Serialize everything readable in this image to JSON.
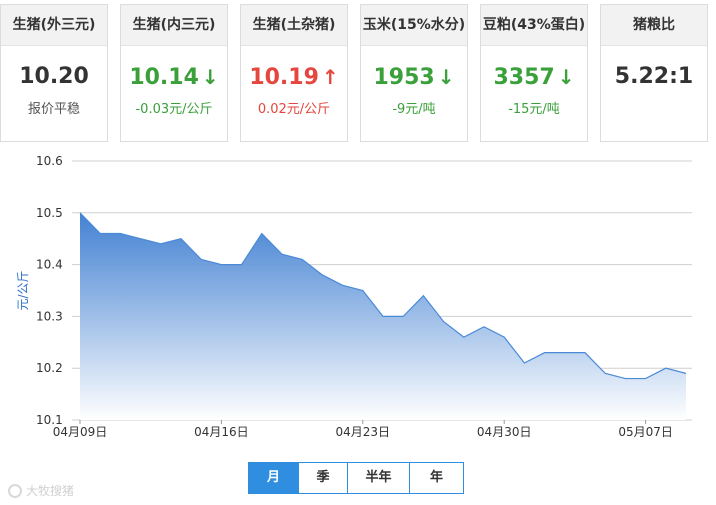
{
  "cards": [
    {
      "title": "生猪(外三元)",
      "value": "10.20",
      "arrow": "",
      "sub": "报价平稳",
      "trend": "flat"
    },
    {
      "title": "生猪(内三元)",
      "value": "10.14",
      "arrow": "↓",
      "sub": "-0.03元/公斤",
      "trend": "down"
    },
    {
      "title": "生猪(土杂猪)",
      "value": "10.19",
      "arrow": "↑",
      "sub": "0.02元/公斤",
      "trend": "up"
    },
    {
      "title": "玉米(15%水分)",
      "value": "1953",
      "arrow": "↓",
      "sub": "-9元/吨",
      "trend": "down"
    },
    {
      "title": "豆粕(43%蛋白)",
      "value": "3357",
      "arrow": "↓",
      "sub": "-15元/吨",
      "trend": "down"
    },
    {
      "title": "猪粮比",
      "value": "5.22:1",
      "arrow": "",
      "sub": "",
      "trend": "flat"
    }
  ],
  "chart_data": {
    "type": "area",
    "ylabel": "元/公斤",
    "xlabel": "",
    "ylim": [
      10.1,
      10.6
    ],
    "y_ticks": [
      "10.6",
      "10.5",
      "10.4",
      "10.3",
      "10.2",
      "10.1"
    ],
    "x_ticks": [
      "04月09日",
      "04月16日",
      "04月23日",
      "04月30日",
      "05月07日"
    ],
    "grid": true,
    "colors": {
      "line": "#4a8ad6",
      "fill_top": "#3a7bd0",
      "fill_bottom": "#ffffff"
    },
    "series": [
      {
        "x": [
          "04-09",
          "04-10",
          "04-11",
          "04-12",
          "04-13",
          "04-14",
          "04-15",
          "04-16",
          "04-17",
          "04-18",
          "04-19",
          "04-20",
          "04-21",
          "04-22",
          "04-23",
          "04-24",
          "04-25",
          "04-26",
          "04-27",
          "04-28",
          "04-29",
          "04-30",
          "05-01",
          "05-02",
          "05-03",
          "05-04",
          "05-05",
          "05-06",
          "05-07",
          "05-08",
          "05-09"
        ],
        "values": [
          10.5,
          10.46,
          10.46,
          10.45,
          10.44,
          10.45,
          10.41,
          10.4,
          10.4,
          10.46,
          10.42,
          10.41,
          10.38,
          10.36,
          10.35,
          10.3,
          10.3,
          10.34,
          10.29,
          10.26,
          10.28,
          10.26,
          10.21,
          10.23,
          10.23,
          10.23,
          10.19,
          10.18,
          10.18,
          10.2,
          10.19
        ]
      }
    ]
  },
  "tabs": [
    {
      "label": "月",
      "active": true
    },
    {
      "label": "季",
      "active": false
    },
    {
      "label": "半年",
      "active": false
    },
    {
      "label": "年",
      "active": false
    }
  ],
  "watermark": {
    "text": "大牧搜猪"
  }
}
